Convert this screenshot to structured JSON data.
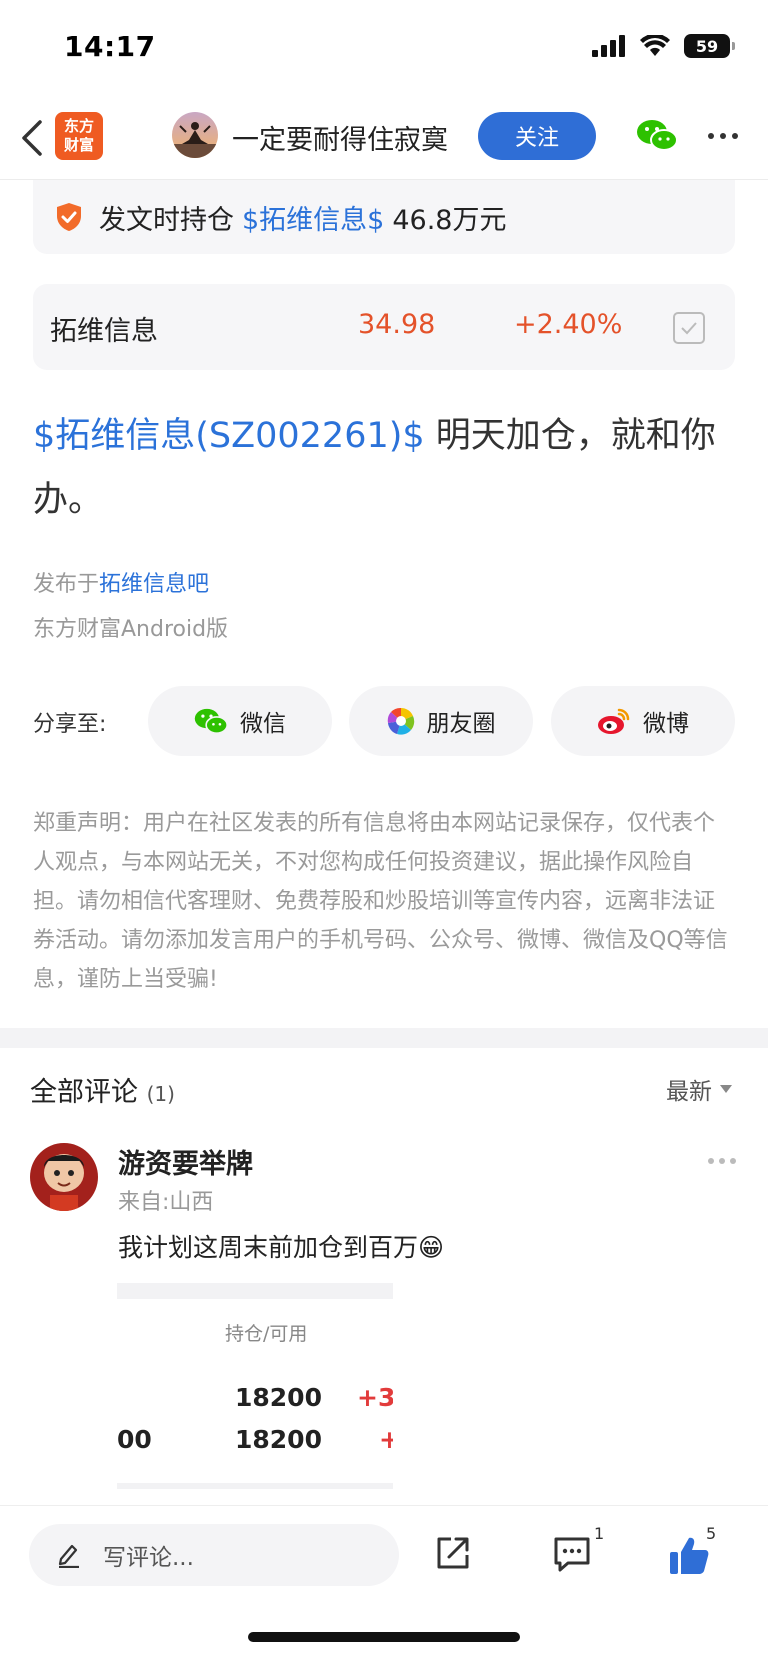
{
  "status_bar": {
    "time": "14:17",
    "battery": "59"
  },
  "nav": {
    "logo_line1": "东方",
    "logo_line2": "财富",
    "author": "一定要耐得住寂寞",
    "follow_label": "关注"
  },
  "holding": {
    "prefix": "发文时持仓",
    "stock": "$拓维信息$",
    "amount": "46.8万元"
  },
  "quote": {
    "name": "拓维信息",
    "price": "34.98",
    "change": "+2.40%"
  },
  "post": {
    "stock_link": "$拓维信息(SZ002261)$",
    "text": " 明天加仓，就和你办。"
  },
  "publish": {
    "prefix": "发布于",
    "forum": "拓维信息吧",
    "client": "东方财富Android版"
  },
  "share": {
    "label": "分享至:",
    "items": [
      {
        "label": "微信",
        "icon": "wechat-icon"
      },
      {
        "label": "朋友圈",
        "icon": "moments-icon"
      },
      {
        "label": "微博",
        "icon": "weibo-icon"
      }
    ]
  },
  "disclaimer": "郑重声明：用户在社区发表的所有信息将由本网站记录保存，仅代表个人观点，与本网站无关，不对您构成任何投资建议，据此操作风险自担。请勿相信代客理财、免费荐股和炒股培训等宣传内容，远离非法证券活动。请勿添加发言用户的手机号码、公众号、微博、微信及QQ等信息，谨防上当受骗!",
  "comments": {
    "title": "全部评论",
    "count": "(1)",
    "sort": "最新",
    "items": [
      {
        "user": "游资要举牌",
        "from": "来自:山西",
        "text": "我计划这周末前加仓到百万😁",
        "image": {
          "header": "持仓/可用",
          "row1_value": "18200",
          "row1_change": "+3",
          "row2_left": "00",
          "row2_value": "18200",
          "row2_change": "+"
        }
      }
    ]
  },
  "bottom_bar": {
    "placeholder": "写评论...",
    "comment_count": "1",
    "like_count": "5"
  }
}
